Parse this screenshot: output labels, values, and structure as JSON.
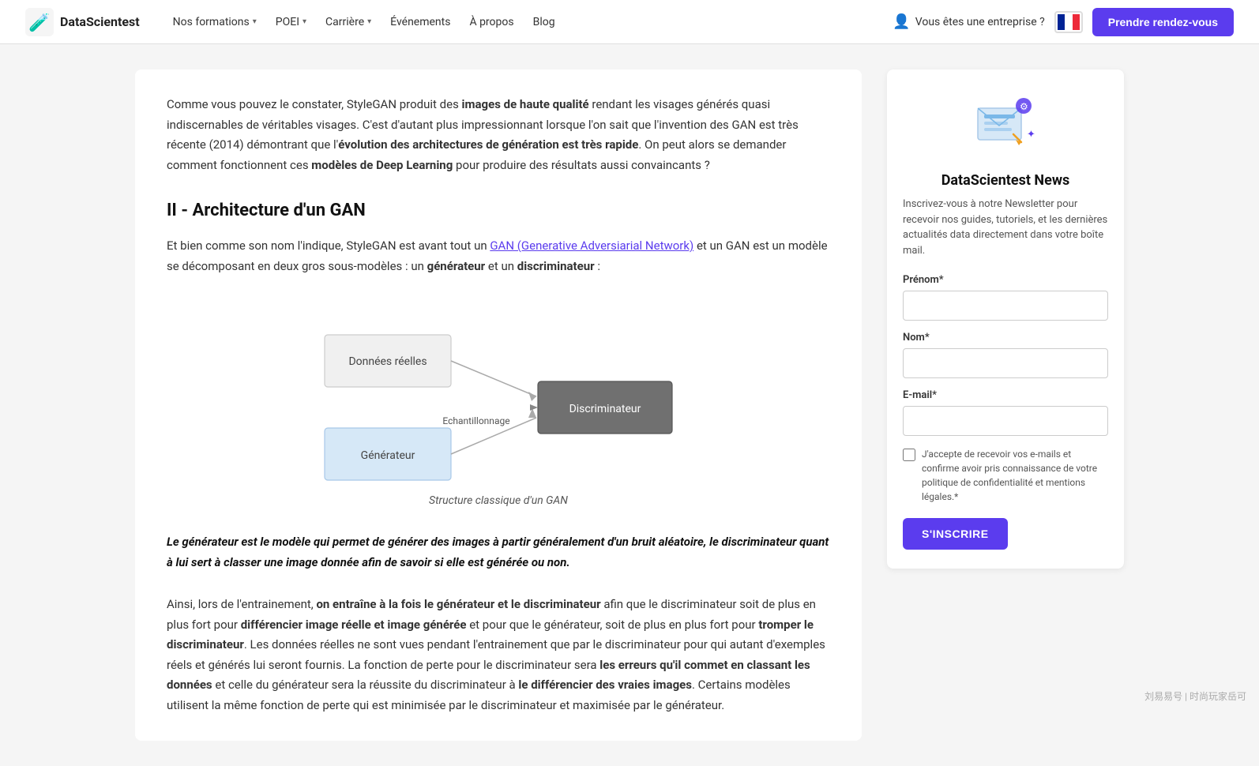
{
  "navbar": {
    "logo_text": "DataScientest",
    "formations_label": "Nos formations",
    "poei_label": "POEI",
    "carriere_label": "Carrière",
    "evenements_label": "Événements",
    "apropos_label": "À propos",
    "blog_label": "Blog",
    "enterprise_label": "Vous êtes une entreprise ?",
    "cta_label": "Prendre rendez-vous"
  },
  "article": {
    "intro_text_1": "Comme vous pouvez le constater, StyleGAN produit des ",
    "intro_bold_1": "images de haute qualité",
    "intro_text_2": " rendant les visages générés quasi indiscernables de véritables visages. C'est d'autant plus impressionnant lorsque l'on sait que l'invention des GAN est très récente (2014) démontrant que l'",
    "intro_bold_2": "évolution des architectures de génération est très rapide",
    "intro_text_3": ". On peut alors se demander comment fonctionnent ces ",
    "intro_bold_3": "modèles de Deep Learning",
    "intro_text_4": " pour produire des résultats aussi convaincants ?",
    "section_heading": "II - Architecture d'un GAN",
    "section_text_1": "Et bien comme son nom l'indique, StyleGAN est avant tout un ",
    "section_link": "GAN (Generative Adversiarial Network)",
    "section_text_2": " et un GAN est un modèle se décomposant en deux gros sous-modèles : un ",
    "section_bold_1": "générateur",
    "section_text_3": " et un ",
    "section_bold_2": "discriminateur",
    "section_text_4": " :",
    "diagram": {
      "box1_label": "Données réelles",
      "box2_label": "Générateur",
      "box3_label": "Discriminateur",
      "arrow_label": "Echantillonnage",
      "caption": "Structure classique d'un GAN"
    },
    "blockquote": "Le générateur est le modèle qui permet de générer des images à partir généralement d'un bruit aléatoire, le discriminateur quant à lui sert à classer une image donnée afin de savoir si elle est générée ou non.",
    "bottom_text_1": "Ainsi, lors de l'entrainement, ",
    "bottom_bold_1": "on entraîne à la fois le générateur et le discriminateur",
    "bottom_text_2": " afin que le discriminateur soit de plus en plus fort pour ",
    "bottom_bold_2": "différencier image réelle et image générée",
    "bottom_text_3": " et pour que le générateur, soit de plus en plus fort pour ",
    "bottom_bold_3": "tromper le discriminateur",
    "bottom_text_4": ". Les données réelles ne sont vues pendant l'entrainement que par le discriminateur pour qui autant d'exemples réels et générés lui seront fournis. La fonction de perte pour le discriminateur sera ",
    "bottom_bold_4": "les erreurs qu'il commet en classant les données",
    "bottom_text_5": " et celle du générateur sera la réussite du discriminateur à ",
    "bottom_bold_5": "le différencier des vraies images",
    "bottom_text_6": ". Certains modèles utilisent la même fonction de perte qui est minimisée par le discriminateur et maximisée par le générateur."
  },
  "sidebar": {
    "newsletter_title": "DataScientest News",
    "newsletter_desc": "Inscrivez-vous à notre Newsletter pour recevoir nos guides, tutoriels, et les dernières actualités data directement dans votre boîte mail.",
    "prenom_label": "Prénom*",
    "nom_label": "Nom*",
    "email_label": "E-mail*",
    "checkbox_label": "J'accepte de recevoir vos e-mails et confirme avoir pris connaissance de votre politique de confidentialité et mentions légales.*",
    "subscribe_label": "S'INSCRIRE"
  }
}
